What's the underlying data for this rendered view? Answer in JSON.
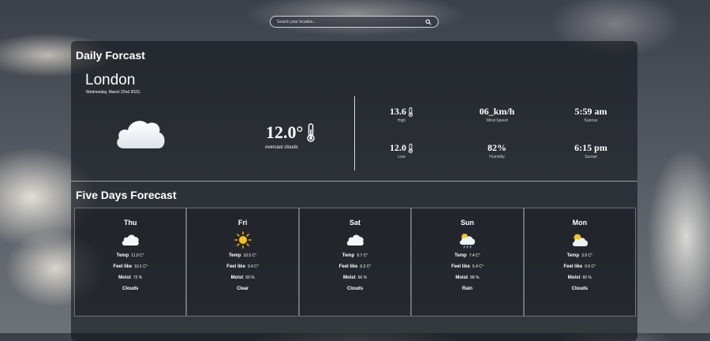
{
  "search": {
    "placeholder": "Search your location..."
  },
  "daily": {
    "title": "Daily Forcast",
    "city": "London",
    "date": "Wednesday, March 22nd 2023,",
    "temp": "12.0°",
    "description": "overcast clouds",
    "stats": [
      {
        "value": "13.6",
        "label": "High",
        "icon": "thermometer-icon"
      },
      {
        "value": "06_km/h",
        "label": "Wind Speed",
        "icon": ""
      },
      {
        "value": "5:59 am",
        "label": "Sunrise",
        "icon": ""
      },
      {
        "value": "12.0",
        "label": "Low",
        "icon": "thermometer-icon"
      },
      {
        "value": "82%",
        "label": "Humidity",
        "icon": ""
      },
      {
        "value": "6:15 pm",
        "label": "Sunset",
        "icon": ""
      }
    ]
  },
  "five_days": {
    "title": "Five Days Forecast",
    "labels": {
      "temp": "Temp",
      "feel": "Feel like",
      "moist": "Moist"
    },
    "days": [
      {
        "name": "Thu",
        "icon": "cloud-icon",
        "temp": "11.0 C°",
        "feel": "10.1 C°",
        "moist": "72 %",
        "cond": "Clouds"
      },
      {
        "name": "Fri",
        "icon": "sun-icon",
        "temp": "10.5 C°",
        "feel": "9.4 C°",
        "moist": "69 %",
        "cond": "Clear"
      },
      {
        "name": "Sat",
        "icon": "cloud-icon",
        "temp": "9.7 C°",
        "feel": "6.3 C°",
        "moist": "66 %",
        "cond": "Clouds"
      },
      {
        "name": "Sun",
        "icon": "rain-cloud-icon",
        "temp": "7.4 C°",
        "feel": "5.4 C°",
        "moist": "88 %",
        "cond": "Rain"
      },
      {
        "name": "Mon",
        "icon": "sun-cloud-icon",
        "temp": "3.9 C°",
        "feel": "0.6 C°",
        "moist": "60 %",
        "cond": "Clouds"
      }
    ]
  }
}
